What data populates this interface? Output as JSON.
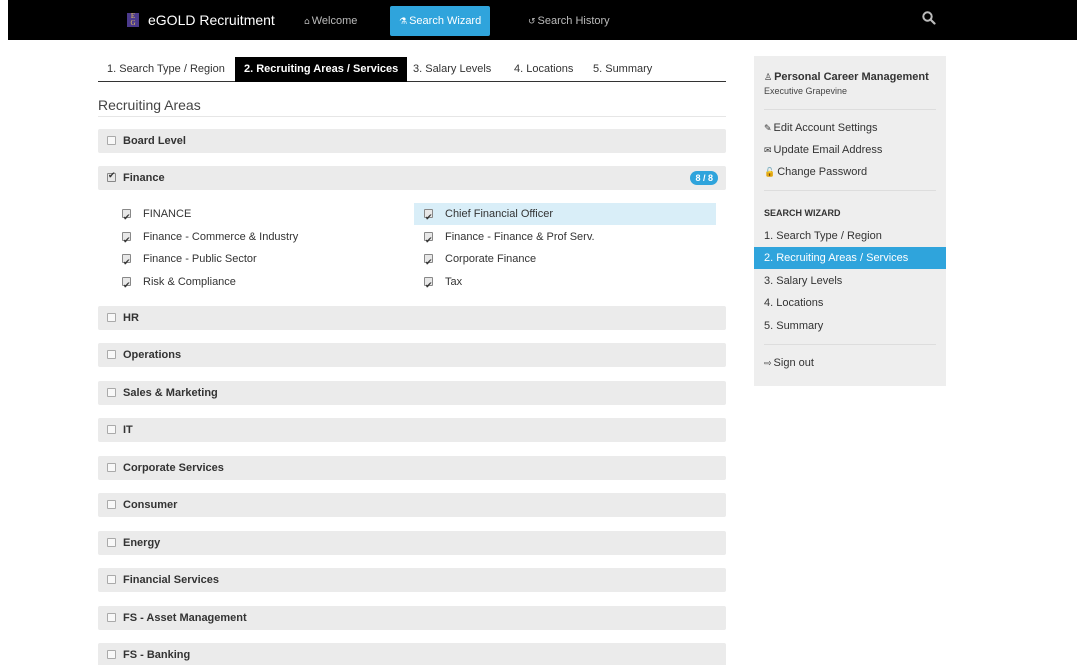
{
  "navbar": {
    "brand": "eGOLD Recruitment",
    "logo_text": "E\nG",
    "welcome": "Welcome",
    "search_wizard": "Search Wizard",
    "search_history": "Search History"
  },
  "tabs": [
    {
      "label": "1. Search Type / Region"
    },
    {
      "label": "2. Recruiting Areas / Services"
    },
    {
      "label": "3. Salary Levels"
    },
    {
      "label": "4. Locations"
    },
    {
      "label": "5. Summary"
    }
  ],
  "section_title": "Recruiting Areas",
  "categories": [
    {
      "label": "Board Level",
      "checked": false
    },
    {
      "label": "Finance",
      "checked": true,
      "badge": "8 / 8"
    },
    {
      "label": "HR",
      "checked": false
    },
    {
      "label": "Operations",
      "checked": false
    },
    {
      "label": "Sales & Marketing",
      "checked": false
    },
    {
      "label": "IT",
      "checked": false
    },
    {
      "label": "Corporate Services",
      "checked": false
    },
    {
      "label": "Consumer",
      "checked": false
    },
    {
      "label": "Energy",
      "checked": false
    },
    {
      "label": "Financial Services",
      "checked": false
    },
    {
      "label": "FS - Asset Management",
      "checked": false
    },
    {
      "label": "FS - Banking",
      "checked": false
    }
  ],
  "finance_items": [
    {
      "label": "FINANCE",
      "checked": true
    },
    {
      "label": "Chief Financial Officer",
      "checked": true
    },
    {
      "label": "Finance - Commerce & Industry",
      "checked": true
    },
    {
      "label": "Finance - Finance & Prof Serv.",
      "checked": true
    },
    {
      "label": "Finance - Public Sector",
      "checked": true
    },
    {
      "label": "Corporate Finance",
      "checked": true
    },
    {
      "label": "Risk & Compliance",
      "checked": true
    },
    {
      "label": "Tax",
      "checked": true
    }
  ],
  "sidebar": {
    "title": "Personal Career Management",
    "subtitle": "Executive Grapevine",
    "edit_account": "Edit Account Settings",
    "update_email": "Update Email Address",
    "change_password": "Change Password",
    "wizard_heading": "SEARCH WIZARD",
    "steps": [
      {
        "label": "1. Search Type / Region"
      },
      {
        "label": "2. Recruiting Areas / Services"
      },
      {
        "label": "3. Salary Levels"
      },
      {
        "label": "4. Locations"
      },
      {
        "label": "5. Summary"
      }
    ],
    "sign_out": "Sign out"
  },
  "colors": {
    "accent": "#2fa4dc",
    "navbar": "#000000",
    "category_bg": "#ebebeb",
    "highlight": "#d9eef8",
    "sidebar_bg": "#eeeeee"
  }
}
